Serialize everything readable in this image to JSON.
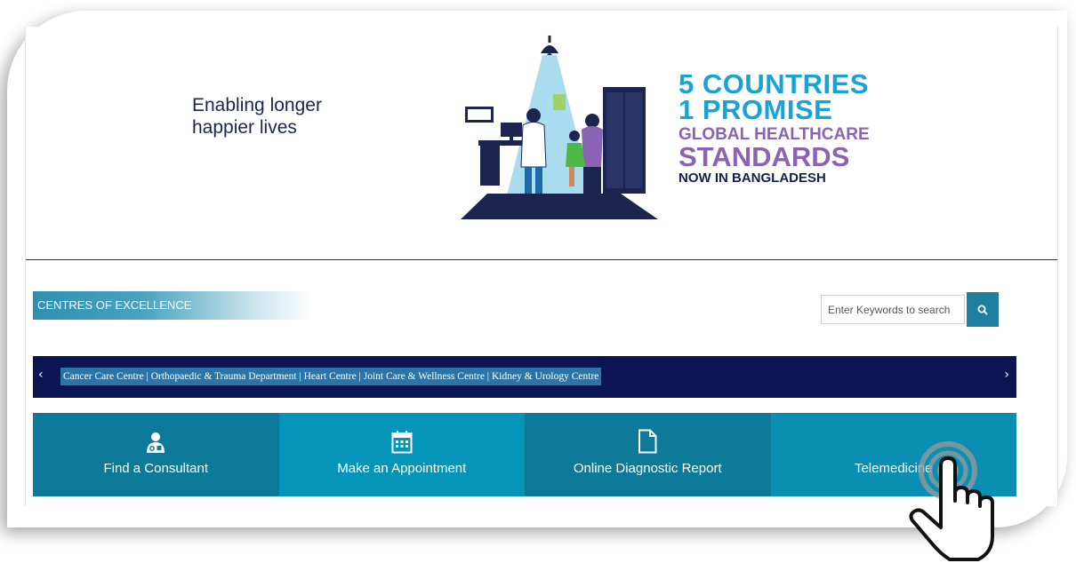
{
  "hero": {
    "tagline": "Enabling longer happier lives",
    "promise_line1": "5 COUNTRIES",
    "promise_line2": "1 PROMISE",
    "promise_line3": "GLOBAL HEALTHCARE",
    "promise_line4": "STANDARDS",
    "promise_line5": "NOW IN BANGLADESH"
  },
  "section": {
    "label": "CENTRES OF EXCELLENCE"
  },
  "search": {
    "placeholder": "Enter Keywords to search",
    "button_icon": "search-icon"
  },
  "ticker": {
    "prev_symbol": "‹",
    "next_symbol": "›",
    "text": "Cancer Care Centre | Orthopaedic & Trauma Department | Heart Centre | Joint Care & Wellness Centre | Kidney & Urology Centre"
  },
  "tiles": [
    {
      "label": "Find a Consultant",
      "icon": "doctor-icon"
    },
    {
      "label": "Make an Appointment",
      "icon": "calendar-icon"
    },
    {
      "label": "Online Diagnostic Report",
      "icon": "document-icon"
    },
    {
      "label": "Telemedicine",
      "icon": "pointer-hand-icon"
    }
  ],
  "colors": {
    "brand_teal": "#0d7a9a",
    "brand_blue": "#0495b8",
    "navy": "#0c1553",
    "promise_blue": "#17a3d4",
    "promise_purple": "#8b63b2"
  }
}
